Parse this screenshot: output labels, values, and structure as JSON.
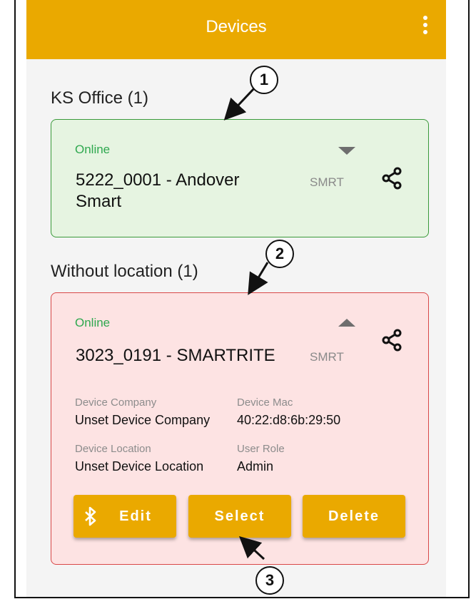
{
  "appbar": {
    "title": "Devices",
    "menu_icon": "more-vertical-icon",
    "color": "#eaa900"
  },
  "groups": [
    {
      "title": "KS Office (1)",
      "status": "Online",
      "device_name": "5222_0001 - Andover Smart",
      "device_type": "SMRT",
      "expanded": false,
      "border_color": "#3a9a3a",
      "background": "#e6f4e1"
    },
    {
      "title": "Without location (1)",
      "status": "Online",
      "device_name": "3023_0191 - SMARTRITE",
      "device_type": "SMRT",
      "expanded": true,
      "border_color": "#d94848",
      "background": "#fde3e3",
      "details": {
        "company_label": "Device Company",
        "company_value": "Unset Device Company",
        "mac_label": "Device Mac",
        "mac_value": "40:22:d8:6b:29:50",
        "location_label": "Device Location",
        "location_value": "Unset Device Location",
        "role_label": "User Role",
        "role_value": "Admin"
      },
      "buttons": {
        "edit": "Edit",
        "select": "Select",
        "delete": "Delete",
        "edit_icon": "bluetooth-icon"
      }
    }
  ],
  "callouts": [
    "1",
    "2",
    "3"
  ],
  "status_color": "#2fa84f"
}
